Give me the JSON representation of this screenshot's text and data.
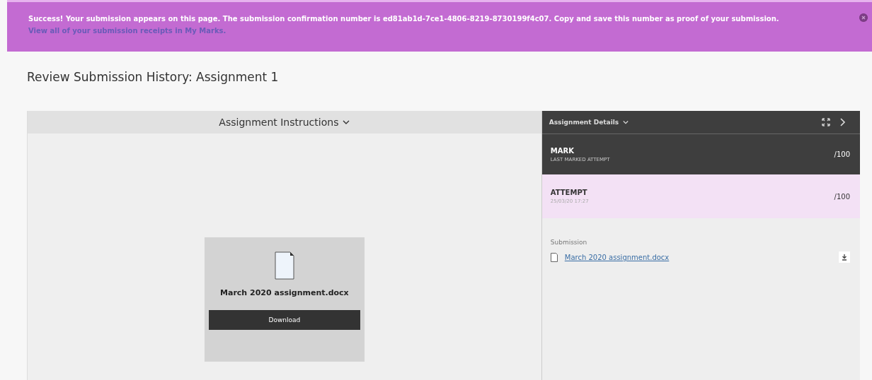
{
  "banner": {
    "message": "Success! Your submission appears on this page. The submission confirmation number is ed81ab1d-7ce1-4806-8219-8730199f4c07. Copy and save this number as proof of your submission.",
    "link": "View all of your submission receipts in My Marks."
  },
  "page_title": "Review Submission History: Assignment 1",
  "instructions": {
    "title": "Assignment Instructions",
    "expanded": false
  },
  "file_card": {
    "name": "March 2020 assignment.docx",
    "button": "Download"
  },
  "details": {
    "title": "Assignment Details",
    "expanded": false,
    "rows": [
      {
        "kind": "mark",
        "label": "MARK",
        "sub": "LAST MARKED ATTEMPT",
        "score": "/100",
        "selected": false
      },
      {
        "kind": "attempt",
        "label": "ATTEMPT",
        "sub": "25/03/20 17:27",
        "score": "/100",
        "selected": true
      }
    ],
    "submission": {
      "label": "Submission",
      "file": "March 2020 assignment.docx"
    }
  }
}
